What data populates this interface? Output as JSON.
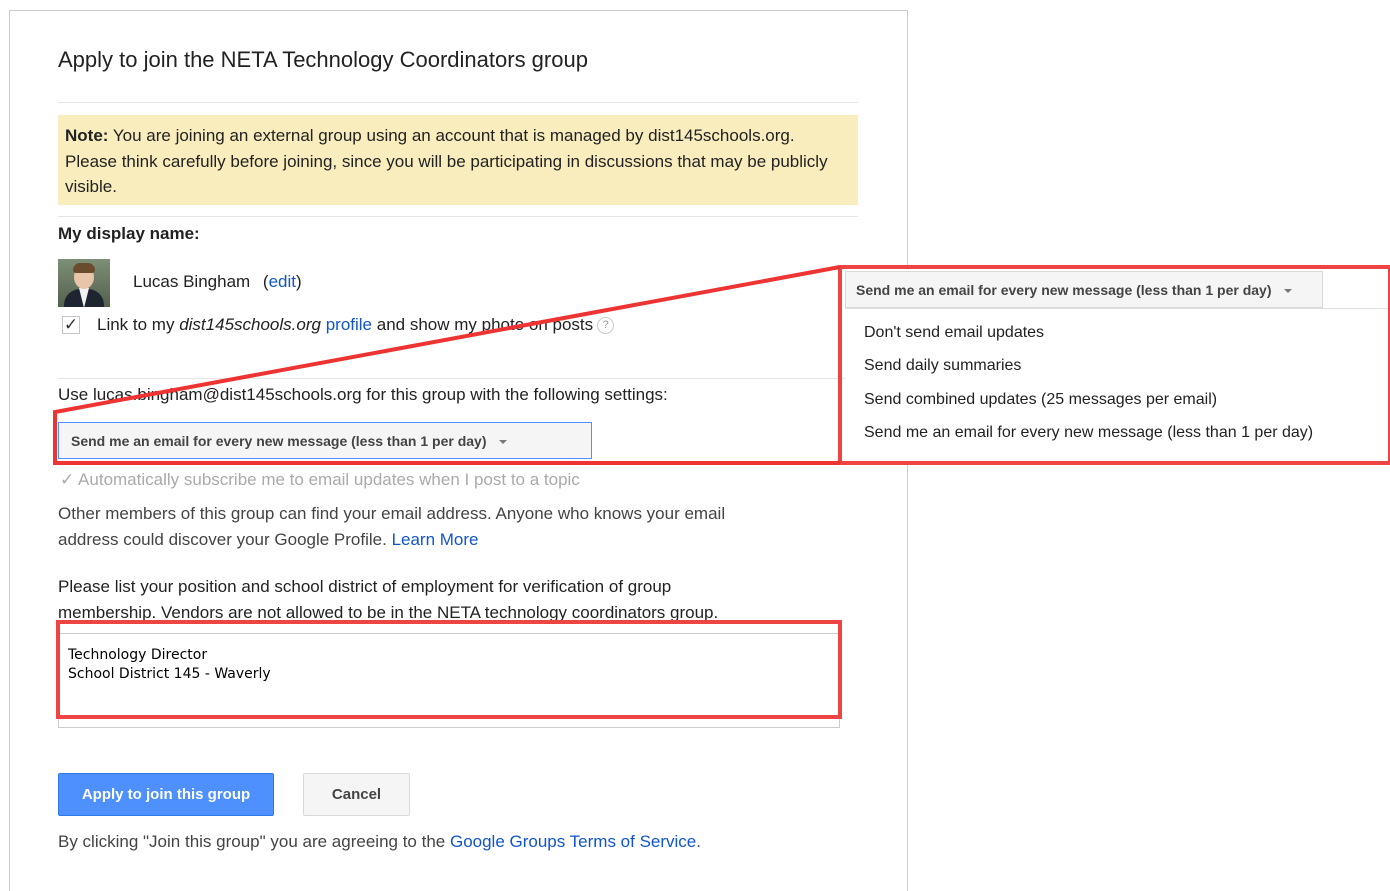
{
  "dialog": {
    "title": "Apply to join the NETA Technology Coordinators group",
    "note_label": "Note:",
    "note_text": " You are joining an external group using an account that is managed by dist145schools.org. Please think carefully before joining, since you will be participating in discussions that may be publicly visible."
  },
  "display_name": {
    "heading": "My display name:",
    "name": "Lucas Bingham",
    "edit_open": "(",
    "edit_link": "edit",
    "edit_close": ")",
    "link_prefix": "Link to my ",
    "domain_italic": "dist145schools.org",
    "profile_link": "profile",
    "link_suffix": " and show my photo on posts",
    "help_icon": "?",
    "checkbox_mark": "✓"
  },
  "email_settings": {
    "intro": "Use lucas.bingham@dist145schools.org for this group with the following settings:",
    "selected": "Send me an email for every new message (less than 1 per day)",
    "auto_subscribe_mark": "✓",
    "auto_subscribe": "Automatically subscribe me to email updates when I post to a topic",
    "privacy_line1": "Other members of this group can find your email address. Anyone who knows your email",
    "privacy_line2": "address could discover your Google Profile. ",
    "learn_more": "Learn More"
  },
  "verification": {
    "prompt_line1": "Please list your position and school district of employment for verification of group",
    "prompt_line2": "membership. Vendors are not allowed to be in the NETA technology coordinators group.",
    "textarea_value": "Technology Director\nSchool District 145 - Waverly"
  },
  "buttons": {
    "apply": "Apply to join this group",
    "cancel": "Cancel"
  },
  "footer": {
    "prefix": "By clicking \"Join this group\" you are agreeing to the ",
    "tos_link": "Google Groups Terms of Service",
    "suffix": "."
  },
  "dropdown_menu": {
    "button": "Send me an email for every new message (less than 1 per day)",
    "options": [
      "Don't send email updates",
      "Send daily summaries",
      "Send combined updates (25 messages per email)",
      "Send me an email for every new message (less than 1 per day)"
    ]
  },
  "colors": {
    "annotation_red": "#ee4444",
    "link_blue": "#1155cc",
    "primary_button": "#4d90fe",
    "note_background": "#f9edbe"
  }
}
